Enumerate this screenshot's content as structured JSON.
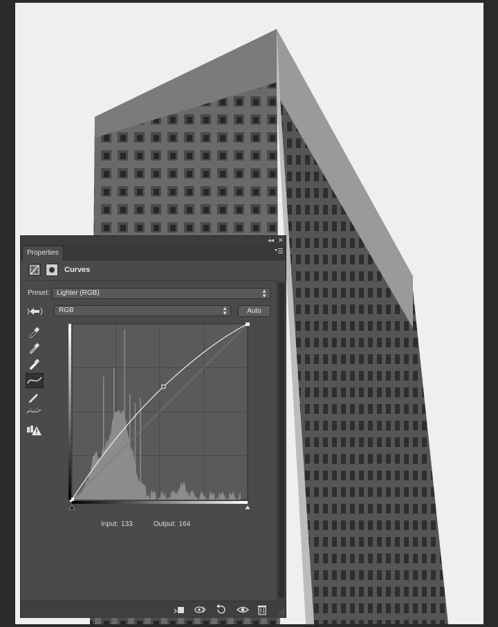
{
  "panel": {
    "collapse_glyph": "◂◂",
    "close_glyph": "✕",
    "tab_label": "Properties",
    "adjustment_title": "Curves"
  },
  "controls": {
    "preset_label": "Preset:",
    "preset_value": "Lighter (RGB)",
    "channel_value": "RGB",
    "auto_label": "Auto"
  },
  "readout": {
    "input_label": "Input:",
    "input_value": "133",
    "output_label": "Output:",
    "output_value": "164"
  },
  "curve": {
    "points": [
      [
        0,
        0
      ],
      [
        133,
        164
      ],
      [
        255,
        255
      ]
    ]
  },
  "icons": {
    "header": [
      "curves-adjustment-icon",
      "layer-mask-icon"
    ],
    "tools": [
      "targeted-adjustment-icon",
      "black-point-eyedropper-icon",
      "gray-point-eyedropper-icon",
      "white-point-eyedropper-icon",
      "curve-points-icon",
      "pencil-icon",
      "smooth-curve-icon",
      "clipping-warning-icon"
    ],
    "footer": [
      "clip-to-layer-icon",
      "view-previous-state-icon",
      "reset-icon",
      "visibility-eye-icon",
      "delete-trash-icon"
    ]
  },
  "colors": {
    "panel_bg": "#4a4a4a",
    "canvas_bg": "#efefef",
    "graph_bg": "#5a5a5a",
    "histogram": "#8c8c8c"
  }
}
